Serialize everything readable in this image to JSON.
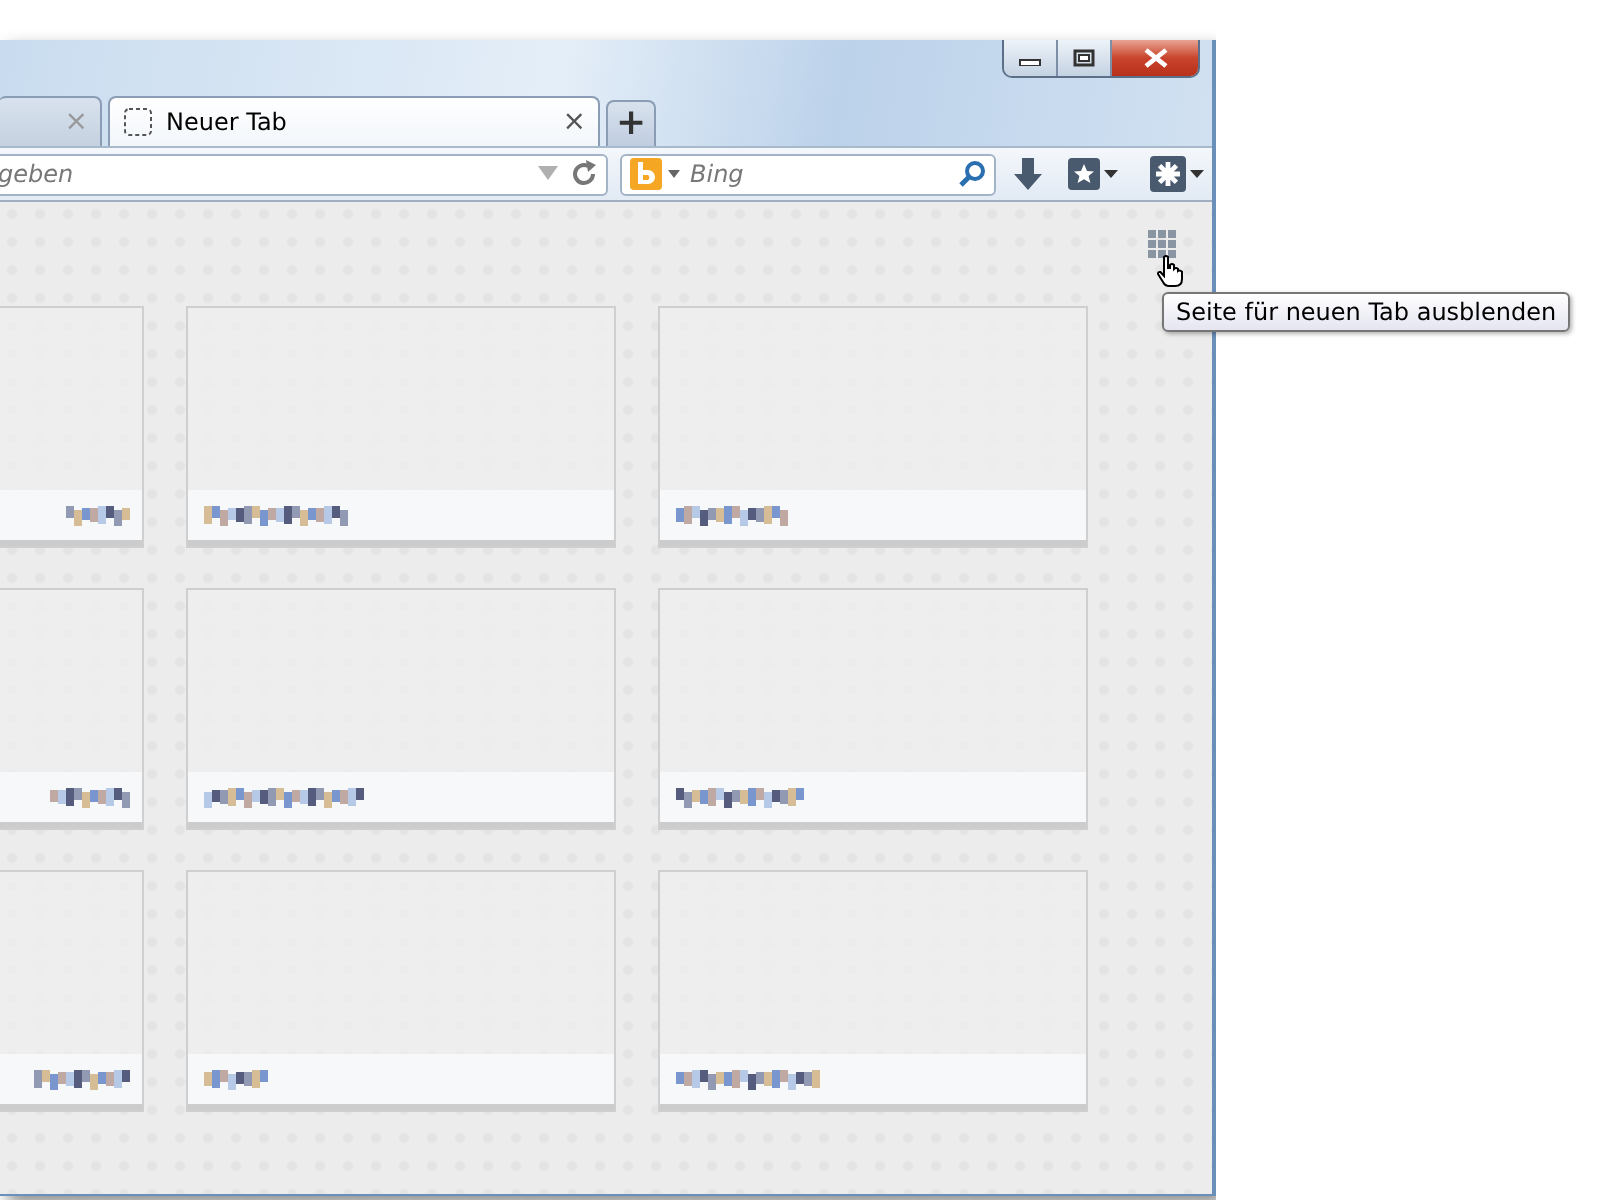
{
  "window": {
    "controls": [
      {
        "kind": "minimize"
      },
      {
        "kind": "maximize"
      },
      {
        "kind": "close"
      }
    ]
  },
  "tabs": [
    {
      "selected": false,
      "close": "×"
    },
    {
      "label": "Neuer Tab",
      "selected": true,
      "close": "×"
    }
  ],
  "new_tab_button": "+",
  "url_bar": {
    "placeholder": "geben"
  },
  "search_bar": {
    "placeholder": "Bing"
  },
  "tiles": [
    {
      "kind": "site"
    },
    {
      "kind": "site"
    },
    {
      "kind": "site"
    },
    {
      "kind": "site"
    },
    {
      "kind": "site"
    },
    {
      "kind": "site"
    },
    {
      "kind": "site"
    },
    {
      "kind": "site"
    },
    {
      "kind": "site"
    }
  ],
  "tooltip": "Seite für neuen Tab ausblenden"
}
